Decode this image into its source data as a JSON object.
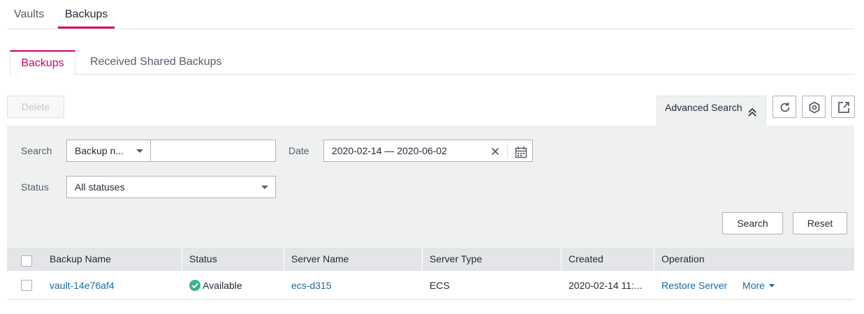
{
  "top_tabs": [
    "Vaults",
    "Backups"
  ],
  "sub_tabs": [
    "Backups",
    "Received Shared Backups"
  ],
  "toolbar": {
    "delete_label": "Delete",
    "advanced_search_label": "Advanced Search"
  },
  "search_panel": {
    "search_label": "Search",
    "search_type_value": "Backup n...",
    "search_input_value": "",
    "date_label": "Date",
    "date_value": "2020-02-14 — 2020-06-02",
    "status_label": "Status",
    "status_value": "All statuses",
    "search_button": "Search",
    "reset_button": "Reset"
  },
  "table": {
    "headers": [
      "Backup Name",
      "Status",
      "Server Name",
      "Server Type",
      "Created",
      "Operation"
    ],
    "rows": [
      {
        "backup_name": "vault-14e76af4",
        "status": "Available",
        "server_name": "ecs-d315",
        "server_type": "ECS",
        "created": "2020-02-14 11:...",
        "op_restore": "Restore Server",
        "op_more": "More"
      }
    ]
  },
  "colors": {
    "accent": "#d1006b",
    "link": "#1a6ba3",
    "status_ok": "#3bb08f",
    "panel_bg": "#eff0f0",
    "header_bg": "#e3e5e8"
  },
  "icons": [
    "refresh-icon",
    "settings-icon",
    "export-icon",
    "chevron-double-up-icon",
    "clear-icon",
    "calendar-icon",
    "available-check-icon"
  ]
}
